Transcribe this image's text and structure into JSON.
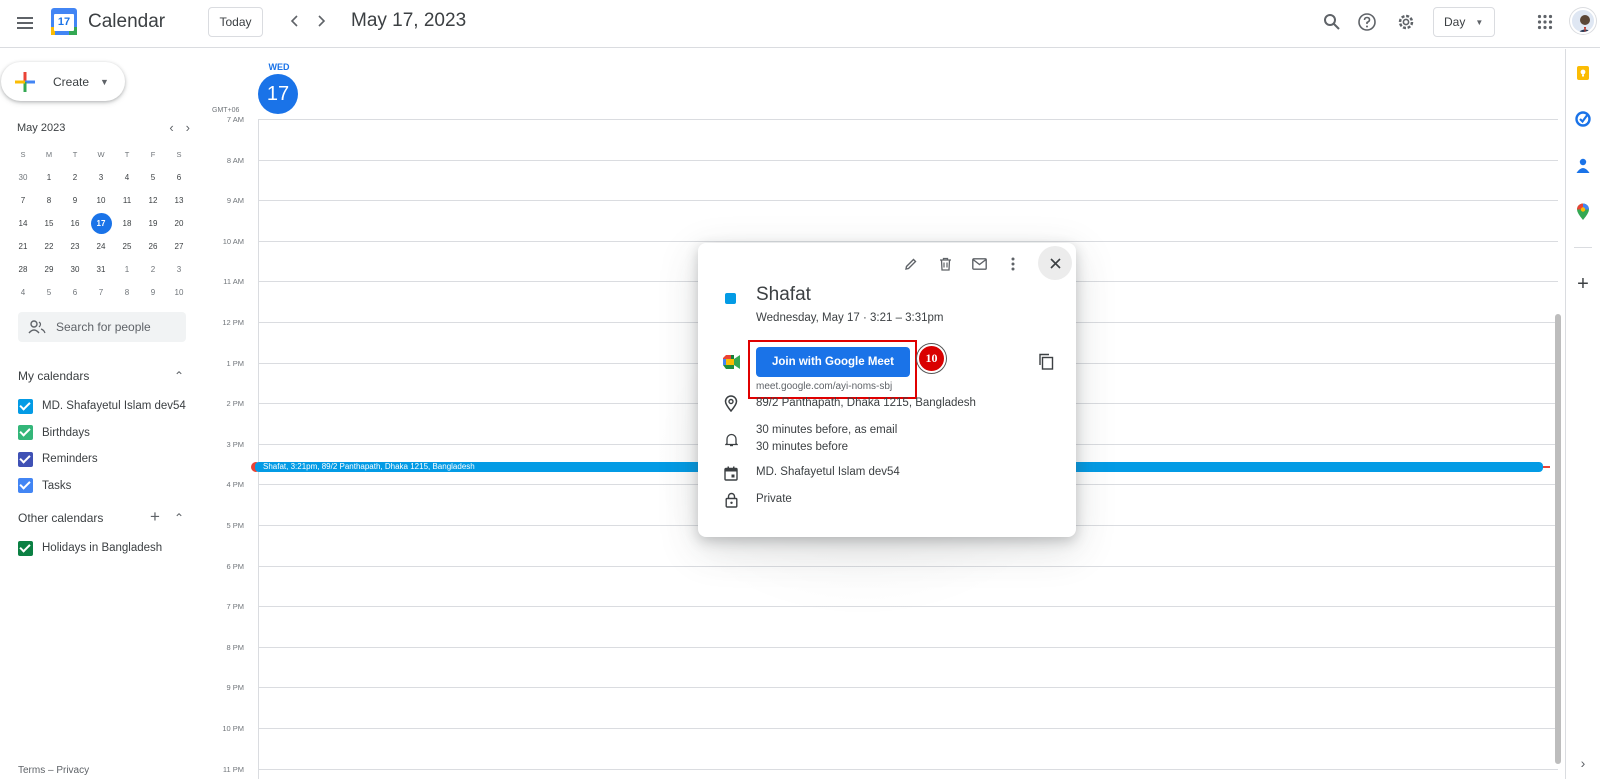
{
  "header": {
    "app_title": "Calendar",
    "logo_day": "17",
    "today_label": "Today",
    "prev_icon": "chevron-left-icon",
    "next_icon": "chevron-right-icon",
    "date_title": "May 17, 2023",
    "view_label": "Day"
  },
  "sidebar": {
    "create_label": "Create",
    "mini_calendar": {
      "month_label": "May 2023",
      "weekdays": [
        "S",
        "M",
        "T",
        "W",
        "T",
        "F",
        "S"
      ],
      "weeks": [
        [
          "30",
          "1",
          "2",
          "3",
          "4",
          "5",
          "6"
        ],
        [
          "7",
          "8",
          "9",
          "10",
          "11",
          "12",
          "13"
        ],
        [
          "14",
          "15",
          "16",
          "17",
          "18",
          "19",
          "20"
        ],
        [
          "21",
          "22",
          "23",
          "24",
          "25",
          "26",
          "27"
        ],
        [
          "28",
          "29",
          "30",
          "31",
          "1",
          "2",
          "3"
        ],
        [
          "4",
          "5",
          "6",
          "7",
          "8",
          "9",
          "10"
        ]
      ],
      "selected_day": "17"
    },
    "search_people_placeholder": "Search for people",
    "my_calendars_label": "My calendars",
    "my_calendars": [
      {
        "label": "MD. Shafayetul Islam dev54",
        "color": "#039be5"
      },
      {
        "label": "Birthdays",
        "color": "#33b679"
      },
      {
        "label": "Reminders",
        "color": "#3f51b5"
      },
      {
        "label": "Tasks",
        "color": "#4285f4"
      }
    ],
    "other_calendars_label": "Other calendars",
    "other_calendars": [
      {
        "label": "Holidays in Bangladesh",
        "color": "#0b8043"
      }
    ],
    "footer": "Terms – Privacy"
  },
  "day_view": {
    "weekday": "WED",
    "day_number": "17",
    "timezone": "GMT+06",
    "hours": [
      "7 AM",
      "8 AM",
      "9 AM",
      "10 AM",
      "11 AM",
      "12 PM",
      "1 PM",
      "2 PM",
      "3 PM",
      "4 PM",
      "5 PM",
      "6 PM",
      "7 PM",
      "8 PM",
      "9 PM",
      "10 PM",
      "11 PM"
    ],
    "event_bar_text": "Shafat, 3:21pm, 89/2 Panthapath, Dhaka 1215, Bangladesh"
  },
  "event_popup": {
    "title": "Shafat",
    "time": "Wednesday, May 17  ·  3:21 – 3:31pm",
    "meet_button": "Join with Google Meet",
    "meet_link": "meet.google.com/ayi-noms-sbj",
    "location": "89/2 Panthapath, Dhaka 1215, Bangladesh",
    "reminder_1": "30 minutes before, as email",
    "reminder_2": "30 minutes before",
    "calendar": "MD. Shafayetul Islam dev54",
    "visibility": "Private",
    "color": "#039be5"
  },
  "annotation": {
    "step_number": "10",
    "highlight_color": "#e00000"
  }
}
